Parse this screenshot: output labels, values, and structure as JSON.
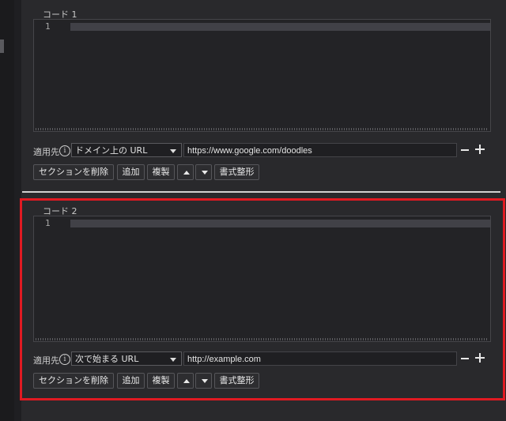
{
  "sections": [
    {
      "title": "コード 1",
      "line_number": "1",
      "apply_label": "適用先",
      "match_type": "ドメイン上の URL",
      "url": "https://www.google.com/doodles",
      "buttons": {
        "delete": "セクションを削除",
        "add": "追加",
        "duplicate": "複製",
        "format": "書式整形"
      }
    },
    {
      "title": "コード 2",
      "line_number": "1",
      "apply_label": "適用先",
      "match_type": "次で始まる URL",
      "url": "http://example.com",
      "buttons": {
        "delete": "セクションを削除",
        "add": "追加",
        "duplicate": "複製",
        "format": "書式整形"
      }
    }
  ],
  "icons": {
    "info": "info-icon",
    "minus": "remove-icon",
    "plus": "add-icon",
    "up": "move-up-icon",
    "down": "move-down-icon"
  },
  "colors": {
    "highlight": "#e01a22",
    "background": "#29292c"
  }
}
